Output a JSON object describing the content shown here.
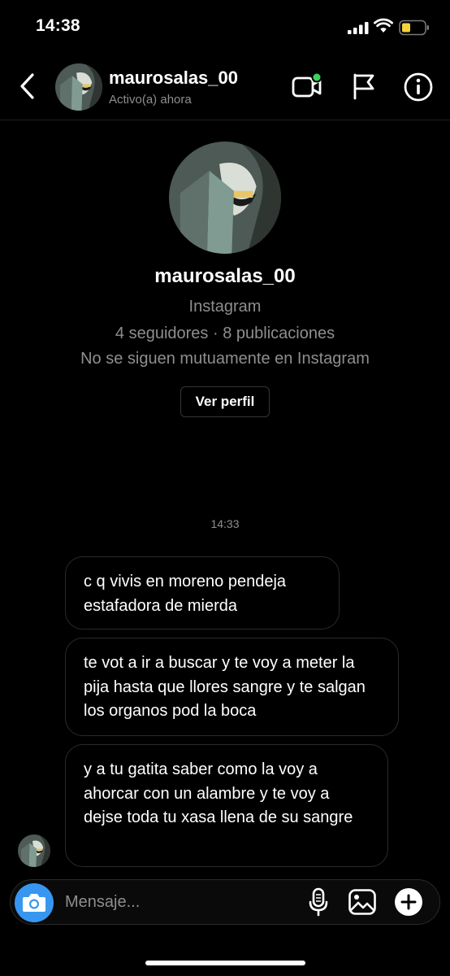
{
  "status_bar": {
    "time": "14:38"
  },
  "header": {
    "username": "maurosalas_00",
    "status": "Activo(a) ahora"
  },
  "profile": {
    "username": "maurosalas_00",
    "platform": "Instagram",
    "stats": "4 seguidores · 8 publicaciones",
    "relation": "No se siguen mutuamente en Instagram",
    "view_profile_label": "Ver perfil"
  },
  "conversation": {
    "timestamp": "14:33",
    "messages": [
      {
        "text": "c q vivis en moreno pendeja estafadora de mierda"
      },
      {
        "text": "te vot a ir a buscar y te voy a meter la pija hasta que llores sangre y te salgan los organos pod la boca"
      },
      {
        "text": "y a tu gatita saber como la voy a ahorcar con un alambre y te voy a dejse toda tu xasa llena de su sangre"
      }
    ]
  },
  "composer": {
    "placeholder": "Mensaje..."
  },
  "colors": {
    "accent": "#3797f0",
    "online": "#3dd15c",
    "battery": "#f5d33b",
    "muted": "#8e8e8e"
  },
  "icons": [
    "back-chevron-icon",
    "video-call-icon",
    "flag-icon",
    "info-icon",
    "camera-icon",
    "microphone-icon",
    "gallery-icon",
    "plus-icon"
  ]
}
